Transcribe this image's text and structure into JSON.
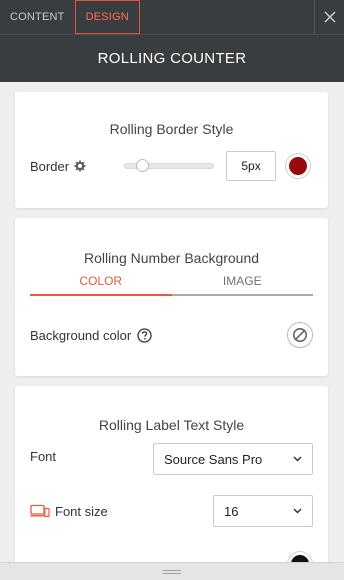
{
  "tabs": [
    {
      "label": "CONTENT",
      "active": false
    },
    {
      "label": "DESIGN",
      "active": true
    }
  ],
  "panel_title": "ROLLING COUNTER",
  "border_section": {
    "title": "Rolling Border Style",
    "label": "Border",
    "value": "5px",
    "slider_fraction": 0.15,
    "color": "#9b0a0a"
  },
  "background_section": {
    "title": "Rolling Number Background",
    "tabs": [
      "COLOR",
      "IMAGE"
    ],
    "active_tab": "COLOR",
    "field_label": "Background color"
  },
  "label_text_section": {
    "title": "Rolling Label Text Style",
    "font_label": "Font",
    "font_value": "Source Sans Pro",
    "font_size_label": "Font size",
    "font_size_value": "16"
  },
  "colors": {
    "accent": "#e65a3c",
    "header_bg": "#393d40"
  },
  "icons": [
    "close-icon",
    "gear-icon",
    "help-icon",
    "no-color-icon",
    "chevron-down-icon",
    "responsive-devices-icon",
    "drag-handle-icon"
  ]
}
